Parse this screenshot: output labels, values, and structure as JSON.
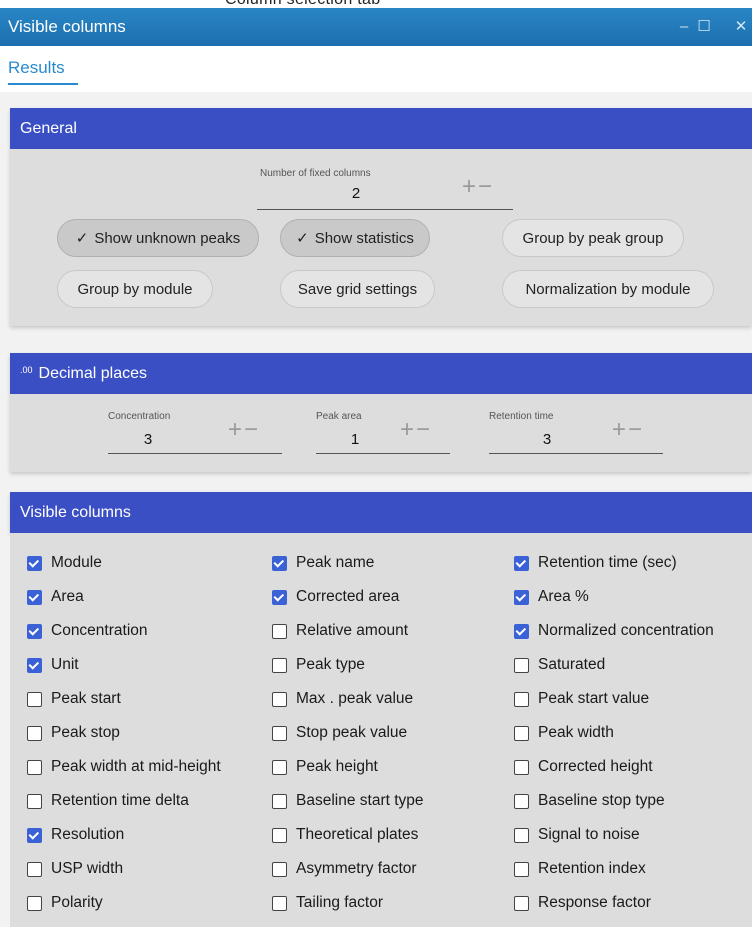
{
  "top_fragment": "Column selection tab",
  "window": {
    "title": "Visible columns",
    "minimize": "–",
    "maximize": "☐",
    "close": "✕"
  },
  "tabs": [
    {
      "label": "Results"
    }
  ],
  "colors": {
    "accent_blue": "#3b4fc4",
    "title_blue": "#1c6fae",
    "tab_blue": "#2a8ad0",
    "check_blue": "#3a62d6"
  },
  "general": {
    "header": "General",
    "fixed_columns_label": "Number of fixed columns",
    "fixed_columns_value": "2",
    "buttons": [
      {
        "label": "Show unknown peaks",
        "checked": true
      },
      {
        "label": "Show statistics",
        "checked": true
      },
      {
        "label": "Group by peak group",
        "checked": false
      },
      {
        "label": "Group by module",
        "checked": false
      },
      {
        "label": "Save grid settings",
        "checked": false
      },
      {
        "label": "Normalization by module",
        "checked": false
      }
    ]
  },
  "decimal_places": {
    "header": "Decimal places",
    "icon": ".00",
    "fields": [
      {
        "label": "Concentration",
        "value": "3"
      },
      {
        "label": "Peak area",
        "value": "1"
      },
      {
        "label": "Retention time",
        "value": "3"
      }
    ]
  },
  "visible_columns": {
    "header": "Visible columns",
    "columns": [
      [
        {
          "label": "Module",
          "checked": true
        },
        {
          "label": "Area",
          "checked": true
        },
        {
          "label": "Concentration",
          "checked": true
        },
        {
          "label": "Unit",
          "checked": true
        },
        {
          "label": "Peak start",
          "checked": false
        },
        {
          "label": "Peak stop",
          "checked": false
        },
        {
          "label": "Peak width at mid-height",
          "checked": false
        },
        {
          "label": "Retention time delta",
          "checked": false
        },
        {
          "label": "Resolution",
          "checked": true
        },
        {
          "label": "USP width",
          "checked": false
        },
        {
          "label": "Polarity",
          "checked": false
        }
      ],
      [
        {
          "label": "Peak name",
          "checked": true
        },
        {
          "label": "Corrected area",
          "checked": true
        },
        {
          "label": "Relative amount",
          "checked": false
        },
        {
          "label": "Peak type",
          "checked": false
        },
        {
          "label": "Max . peak value",
          "checked": false
        },
        {
          "label": "Stop peak value",
          "checked": false
        },
        {
          "label": "Peak height",
          "checked": false
        },
        {
          "label": "Baseline start type",
          "checked": false
        },
        {
          "label": "Theoretical plates",
          "checked": false
        },
        {
          "label": "Asymmetry factor",
          "checked": false
        },
        {
          "label": "Tailing factor",
          "checked": false
        }
      ],
      [
        {
          "label": "Retention time (sec)",
          "checked": true
        },
        {
          "label": "Area %",
          "checked": true
        },
        {
          "label": "Normalized concentration",
          "checked": true
        },
        {
          "label": "Saturated",
          "checked": false
        },
        {
          "label": "Peak start value",
          "checked": false
        },
        {
          "label": "Peak width",
          "checked": false
        },
        {
          "label": "Corrected height",
          "checked": false
        },
        {
          "label": "Baseline stop type",
          "checked": false
        },
        {
          "label": "Signal to noise",
          "checked": false
        },
        {
          "label": "Retention index",
          "checked": false
        },
        {
          "label": "Response factor",
          "checked": false
        }
      ]
    ]
  }
}
